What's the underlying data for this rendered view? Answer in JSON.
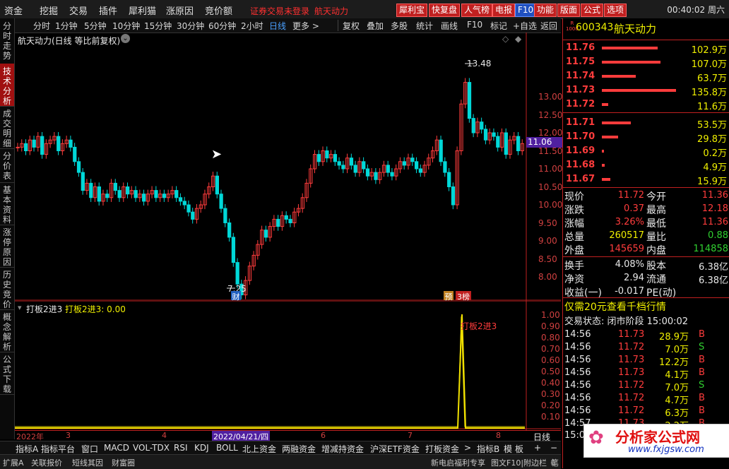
{
  "menu": {
    "items": [
      "资金",
      "挖掘",
      "交易",
      "插件",
      "犀利猫",
      "涨原因",
      "竞价额"
    ],
    "warning": "证券交易未登录",
    "stock_name": "航天动力",
    "buttons": [
      "犀利宝",
      "快复盘",
      "人气榜",
      "电报",
      "F10",
      "功能",
      "版面",
      "公式",
      "选项"
    ],
    "clock": "00:40:02 周六"
  },
  "left_tabs": [
    "分时走势",
    "技术分析",
    "成交明细",
    "分价表",
    "基本资料",
    "涨停原因",
    "历史竞价",
    "概念解析",
    "公式下载"
  ],
  "periods": [
    "分时",
    "1分钟",
    "5分钟",
    "10分钟",
    "15分钟",
    "30分钟",
    "60分钟",
    "2小时",
    "日线",
    "更多 >"
  ],
  "tools": [
    "复权",
    "叠加",
    "多股",
    "统计",
    "画线",
    "F10",
    "标记",
    "+自选",
    "返回"
  ],
  "chart": {
    "title": "航天动力(日线 等比前复权)",
    "price_labels": [
      "13.00",
      "12.50",
      "12.00",
      "11.50",
      "11.00",
      "10.50",
      "10.00",
      "9.50",
      "9.00",
      "8.50",
      "8.00"
    ],
    "last_price_tag": "11.06",
    "high_label": "13.48",
    "low_label": "7.25",
    "badge_cai": "财",
    "badge_yu": "预",
    "badge_bang": "3榜"
  },
  "indicator": {
    "name": "打板2进3",
    "value_label": "打板2进3: 0.00",
    "signal_label": "打板2进3",
    "ylabels": [
      "1.00",
      "0.90",
      "0.80",
      "0.70",
      "0.60",
      "0.50",
      "0.40",
      "0.30",
      "0.20",
      "0.10"
    ]
  },
  "date_axis": {
    "labels": [
      "2022年",
      "3",
      "4",
      "2022/04/21/四",
      "6",
      "7",
      "8"
    ],
    "period": "日线"
  },
  "bottom_tabs": [
    "指标A",
    "指标平台",
    "窗口",
    "MACD",
    "VOL-TDX",
    "RSI",
    "KDJ",
    "BOLL",
    "北上资金",
    "两融资金",
    "增减持资金",
    "沪深ETF资金",
    "打板资金",
    ">",
    "指标B",
    "模",
    "板",
    "+",
    "−"
  ],
  "bottom_tabs2": [
    "扩展A",
    "关联报价",
    "短线其因",
    "财富圈",
    "新电启福利专享",
    "图文F10|附边栏《",
    "笔"
  ],
  "quote": {
    "badge": "R\n1000",
    "code": "600343",
    "name": "航天动力",
    "asks": [
      {
        "price": "11.76",
        "vol": "102.9万",
        "bar": 0.72
      },
      {
        "price": "11.75",
        "vol": "107.0万",
        "bar": 0.75
      },
      {
        "price": "11.74",
        "vol": "63.7万",
        "bar": 0.44
      },
      {
        "price": "11.73",
        "vol": "135.8万",
        "bar": 0.95
      },
      {
        "price": "11.72",
        "vol": "11.6万",
        "bar": 0.08
      }
    ],
    "bids": [
      {
        "price": "11.71",
        "vol": "53.5万",
        "bar": 0.37
      },
      {
        "price": "11.70",
        "vol": "29.8万",
        "bar": 0.21
      },
      {
        "price": "11.69",
        "vol": "0.2万",
        "bar": 0.02
      },
      {
        "price": "11.68",
        "vol": "4.9万",
        "bar": 0.04
      },
      {
        "price": "11.67",
        "vol": "15.9万",
        "bar": 0.11
      }
    ],
    "stats": [
      {
        "l1": "现价",
        "v1": "11.72",
        "c1": "red",
        "l2": "今开",
        "v2": "11.36",
        "c2": "red"
      },
      {
        "l1": "涨跌",
        "v1": "0.37",
        "c1": "red",
        "l2": "最高",
        "v2": "12.18",
        "c2": "red"
      },
      {
        "l1": "涨幅",
        "v1": "3.26%",
        "c1": "red",
        "l2": "最低",
        "v2": "11.36",
        "c2": "red"
      },
      {
        "l1": "总量",
        "v1": "260517",
        "c1": "yel",
        "l2": "量比",
        "v2": "0.88",
        "c2": "grn"
      },
      {
        "l1": "外盘",
        "v1": "145659",
        "c1": "red",
        "l2": "内盘",
        "v2": "114858",
        "c2": "grn"
      }
    ],
    "stats2": [
      {
        "l1": "换手",
        "v1": "4.08%",
        "l2": "股本",
        "v2": "6.38亿"
      },
      {
        "l1": "净资",
        "v1": "2.94",
        "l2": "流通",
        "v2": "6.38亿"
      },
      {
        "l1": "收益(一)",
        "v1": "-0.017",
        "l2": "PE(动)",
        "v2": ""
      }
    ],
    "promo": "仅需20元查看千档行情",
    "trade_status": "交易状态: 闭市阶段 15:00:02",
    "ticks": [
      {
        "t": "14:56",
        "p": "11.73",
        "v": "28.9万",
        "d": "B",
        "c": "red"
      },
      {
        "t": "14:56",
        "p": "11.72",
        "v": "7.0万",
        "d": "S",
        "c": "grn"
      },
      {
        "t": "14:56",
        "p": "11.73",
        "v": "12.2万",
        "d": "B",
        "c": "red"
      },
      {
        "t": "14:56",
        "p": "11.73",
        "v": "4.1万",
        "d": "B",
        "c": "red"
      },
      {
        "t": "14:56",
        "p": "11.72",
        "v": "7.0万",
        "d": "S",
        "c": "grn"
      },
      {
        "t": "14:56",
        "p": "11.72",
        "v": "4.7万",
        "d": "B",
        "c": "red"
      },
      {
        "t": "14:56",
        "p": "11.72",
        "v": "6.3万",
        "d": "B",
        "c": "red"
      },
      {
        "t": "14:57",
        "p": "11.73",
        "v": "2.2万",
        "d": "B",
        "c": "red"
      }
    ],
    "last_tick_time": "15:0"
  },
  "watermark": {
    "title": "分析家公式网",
    "url": "www.fxjgsw.com"
  },
  "colors": {
    "up": "#ff3c3c",
    "down": "#00d8d8",
    "indicator": "#f0e000",
    "bg": "#000000"
  }
}
